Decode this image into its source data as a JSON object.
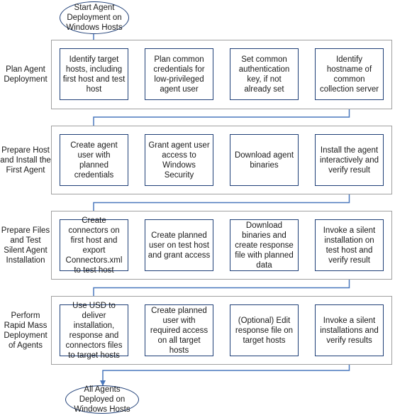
{
  "colors": {
    "connector": "#4a78bd",
    "step_border": "#1f3f77",
    "group_border": "#a0a0a0"
  },
  "start": {
    "label": "Start Agent Deployment on Windows Hosts"
  },
  "end": {
    "label": "All Agents Deployed on Windows Hosts"
  },
  "phases": [
    {
      "label": "Plan Agent Deployment",
      "steps": [
        "Identify target hosts, including first host and test host",
        "Plan common credentials for low-privileged agent user",
        "Set common authentication key, if not already set",
        "Identify hostname of common collection server"
      ]
    },
    {
      "label": "Prepare Host and Install the First Agent",
      "steps": [
        "Create agent user with planned credentials",
        "Grant agent user access to Windows Security",
        "Download agent binaries",
        "Install the agent interactively and verify result"
      ]
    },
    {
      "label": "Prepare Files and Test Silent Agent Installation",
      "steps": [
        "Create connectors on first host and export Connectors.xml to test host",
        "Create planned user on test host and grant access",
        "Download binaries and create response file with planned data",
        "Invoke a silent installation on test host and verify result"
      ]
    },
    {
      "label": "Perform Rapid Mass Deployment of Agents",
      "steps": [
        "Use USD to deliver installation, response and connectors files to target hosts",
        "Create planned user with required access on all target hosts",
        "(Optional) Edit response file on target hosts",
        "Invoke a silent installations and verify results"
      ]
    }
  ]
}
